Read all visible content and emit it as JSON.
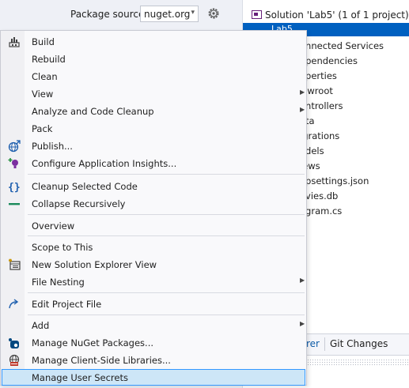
{
  "nuget": {
    "package_source_label": "Package source:",
    "package_source_value": "nuget.org",
    "gear_icon": "gear-icon"
  },
  "solution_explorer": {
    "root_label": "Solution 'Lab5' (1 of 1 project)",
    "selected_label": "Lab5",
    "items": [
      "onnected Services",
      "ependencies",
      "operties",
      "wwroot",
      "ontrollers",
      "ata",
      "igrations",
      "odels",
      "iews",
      "opsettings.json",
      "ovies.db",
      "ogram.cs"
    ],
    "tabs": [
      "rer",
      "Git Changes"
    ]
  },
  "menu": {
    "items": [
      {
        "label": "Build",
        "icon": "build-icon"
      },
      {
        "label": "Rebuild"
      },
      {
        "label": "Clean"
      },
      {
        "label": "View",
        "submenu": true
      },
      {
        "label": "Analyze and Code Cleanup",
        "submenu": true
      },
      {
        "label": "Pack"
      },
      {
        "label": "Publish...",
        "icon": "publish-globe-icon"
      },
      {
        "label": "Configure Application Insights...",
        "icon": "insights-bulb-icon"
      },
      {
        "label": "Cleanup Selected Code",
        "icon": "braces-icon"
      },
      {
        "label": "Collapse Recursively",
        "icon": "collapse-icon"
      },
      {
        "label": "Overview"
      },
      {
        "label": "Scope to This"
      },
      {
        "label": "New Solution Explorer View",
        "icon": "new-view-icon"
      },
      {
        "label": "File Nesting",
        "submenu": true
      },
      {
        "label": "Edit Project File",
        "icon": "edit-arrow-icon"
      },
      {
        "label": "Add",
        "submenu": true
      },
      {
        "label": "Manage NuGet Packages...",
        "icon": "nuget-icon"
      },
      {
        "label": "Manage Client-Side Libraries...",
        "icon": "libraries-icon"
      },
      {
        "label": "Manage User Secrets"
      }
    ]
  }
}
